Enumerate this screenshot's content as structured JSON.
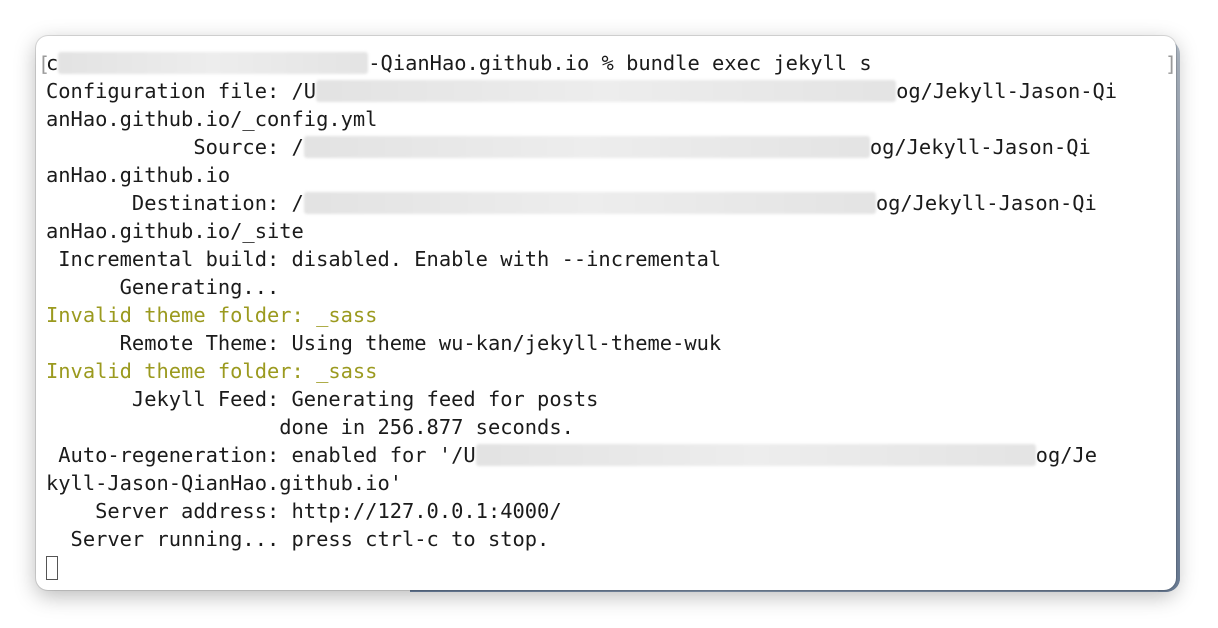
{
  "terminal": {
    "prompt_prefix": "c",
    "prompt_suffix": "-QianHao.github.io % bundle exec jekyll s",
    "lines": [
      {
        "label": "Configuration file: /U",
        "tail": "og/Jekyll-Jason-Qi"
      },
      {
        "text": "anHao.github.io/_config.yml"
      },
      {
        "label": "            Source: /",
        "tail": "og/Jekyll-Jason-Qi"
      },
      {
        "text": "anHao.github.io"
      },
      {
        "label": "       Destination: /",
        "tail": "og/Jekyll-Jason-Qi"
      },
      {
        "text": "anHao.github.io/_site"
      },
      {
        "text": " Incremental build: disabled. Enable with --incremental"
      },
      {
        "text": "      Generating..."
      },
      {
        "text": "Invalid theme folder: _sass"
      },
      {
        "text": "      Remote Theme: Using theme wu-kan/jekyll-theme-wuk"
      },
      {
        "text": "Invalid theme folder: _sass"
      },
      {
        "text": "       Jekyll Feed: Generating feed for posts"
      },
      {
        "text": "                   done in 256.877 seconds."
      },
      {
        "label": " Auto-regeneration: enabled for '/U",
        "tail": "og/Je"
      },
      {
        "text": "kyll-Jason-QianHao.github.io'"
      },
      {
        "text": "    Server address: http://127.0.0.1:4000/"
      },
      {
        "text": "  Server running... press ctrl-c to stop."
      }
    ]
  },
  "colors": {
    "text": "#1b1b1b",
    "warning": "#9b9a1f",
    "background": "#ffffff"
  }
}
